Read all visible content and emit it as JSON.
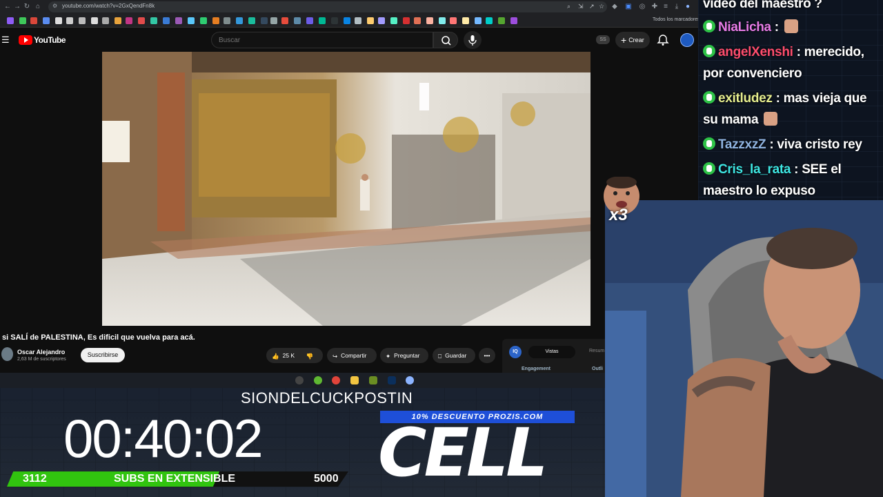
{
  "browser": {
    "url": "youtube.com/watch?v=2GxQendFn8k",
    "bookmarks_label": "Todos los marcadores"
  },
  "youtube": {
    "logo_text": "YouTube",
    "search_placeholder": "Buscar",
    "ss_badge": "SS",
    "create_label": "Crear",
    "video_title": "si SALÍ de PALESTINA, Es dificil que vuelva para acá.",
    "channel_name": "Oscar Alejandro",
    "channel_subs": "2,63 M de suscriptores",
    "subscribe_label": "Suscribirse",
    "likes": "25 K",
    "share_label": "Compartir",
    "ask_label": "Preguntar",
    "save_label": "Guardar"
  },
  "extension": {
    "logo": "IQ",
    "tab_active": "Vistas",
    "tab_other": "Resum",
    "engagement_label": "Engagement",
    "outline_label": "Outli"
  },
  "overlay": {
    "ticker_text": "SIONDELCUCKPOSTIN",
    "timer": "00:40:02",
    "promo": "10% DESCUENTO PROZIS.COM",
    "logo": "CELL",
    "subs_current": "3112",
    "subs_label": "SUBS EN EXTENSIBLE",
    "subs_goal": "5000",
    "subs_progress": 0.6224,
    "x3_label": "x3"
  },
  "chat": {
    "messages": [
      {
        "user": "",
        "text": "video del maestro ?",
        "color": "#ffffff"
      },
      {
        "user": "NiaLicha",
        "text": " : ",
        "color": "#e77be6",
        "emote": true
      },
      {
        "user": "angelXenshi",
        "text": " : merecido, por convenciero",
        "color": "#ff4d6d"
      },
      {
        "user": "exitludez",
        "text": " : mas vieja que su mama ",
        "color": "#e6ee8e",
        "emote": true
      },
      {
        "user": "TazzxzZ",
        "text": " : viva cristo rey",
        "color": "#8fb3e0"
      },
      {
        "user": "Cris_la_rata",
        "text": " : SEE el maestro lo expuso",
        "color": "#3ee6e3"
      }
    ]
  },
  "colors": {
    "youtube_red": "#ff0000",
    "progress_green": "#31c40f",
    "promo_blue": "#1e4fd8",
    "chat_badge": "#2ec247"
  }
}
